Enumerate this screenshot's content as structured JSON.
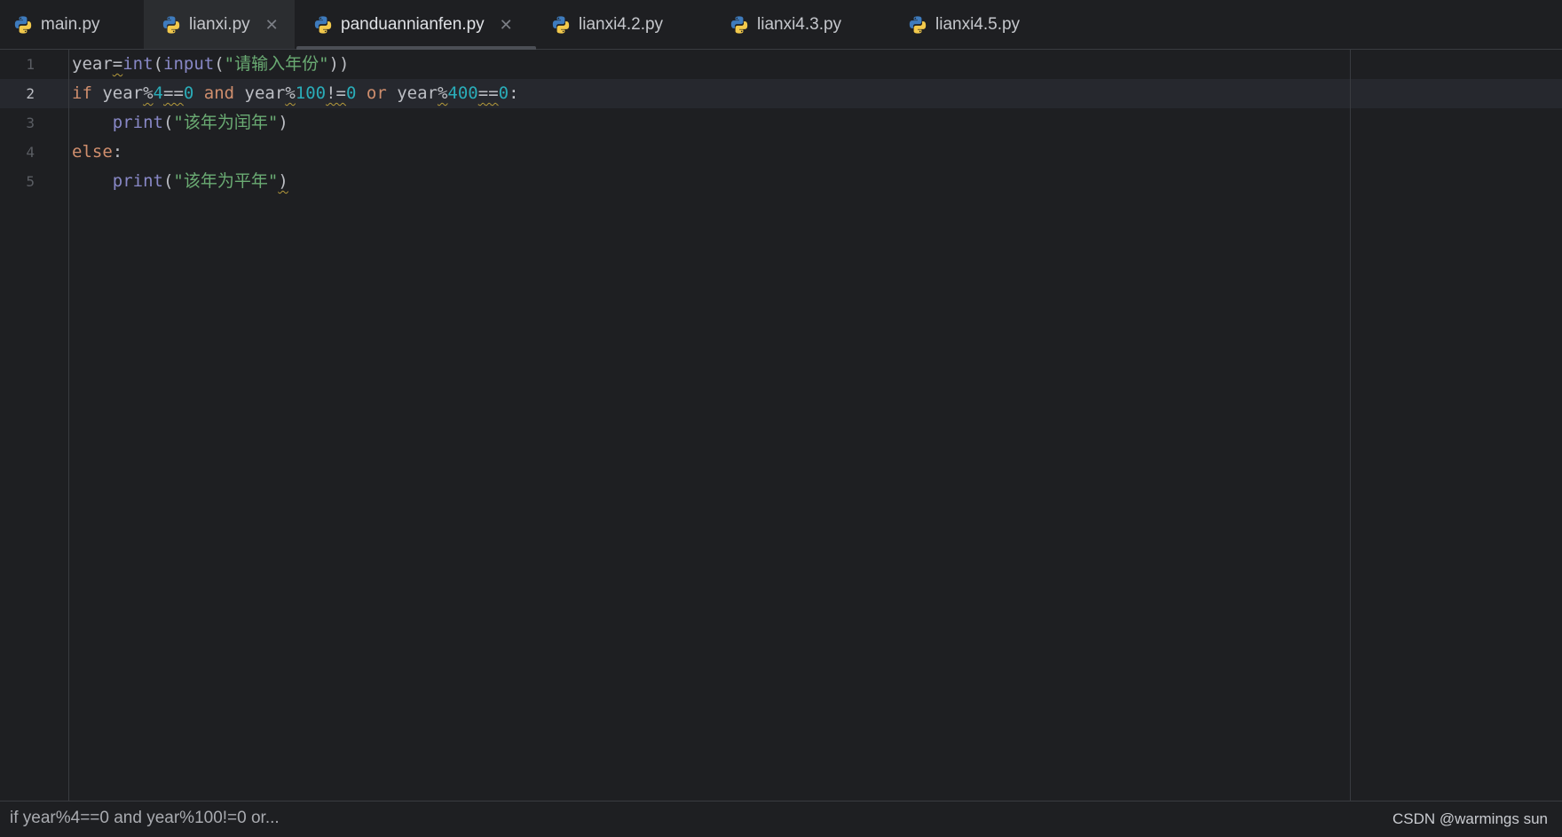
{
  "tabs": [
    {
      "label": "main.py",
      "icon": "python-file-icon",
      "closable": false,
      "active": false
    },
    {
      "label": "lianxi.py",
      "icon": "python-file-icon",
      "closable": true,
      "active": false
    },
    {
      "label": "panduannianfen.py",
      "icon": "python-file-icon",
      "closable": true,
      "active": true
    },
    {
      "label": "lianxi4.2.py",
      "icon": "python-file-icon",
      "closable": false,
      "active": false
    },
    {
      "label": "lianxi4.3.py",
      "icon": "python-file-icon",
      "closable": false,
      "active": false
    },
    {
      "label": "lianxi4.5.py",
      "icon": "python-file-icon",
      "closable": false,
      "active": false
    }
  ],
  "editor": {
    "line_numbers": [
      "1",
      "2",
      "3",
      "4",
      "5"
    ],
    "current_line": 2,
    "lines": [
      [
        {
          "t": "year",
          "c": "ident"
        },
        {
          "t": "=",
          "c": "op",
          "warn": true
        },
        {
          "t": "int",
          "c": "fn"
        },
        {
          "t": "(",
          "c": "op"
        },
        {
          "t": "input",
          "c": "fn"
        },
        {
          "t": "(",
          "c": "op"
        },
        {
          "t": "\"请输入年份\"",
          "c": "str"
        },
        {
          "t": "))",
          "c": "op"
        }
      ],
      [
        {
          "t": "if",
          "c": "kw"
        },
        {
          "t": " year",
          "c": "ident"
        },
        {
          "t": "%",
          "c": "op",
          "warn": true
        },
        {
          "t": "4",
          "c": "num"
        },
        {
          "t": "==",
          "c": "op",
          "warn": true
        },
        {
          "t": "0",
          "c": "num"
        },
        {
          "t": " and",
          "c": "kw"
        },
        {
          "t": " year",
          "c": "ident"
        },
        {
          "t": "%",
          "c": "op",
          "warn": true
        },
        {
          "t": "100",
          "c": "num"
        },
        {
          "t": "!=",
          "c": "op",
          "warn": true
        },
        {
          "t": "0",
          "c": "num"
        },
        {
          "t": " or",
          "c": "kw"
        },
        {
          "t": " year",
          "c": "ident"
        },
        {
          "t": "%",
          "c": "op",
          "warn": true
        },
        {
          "t": "400",
          "c": "num"
        },
        {
          "t": "==",
          "c": "op",
          "warn": true
        },
        {
          "t": "0",
          "c": "num"
        },
        {
          "t": ":",
          "c": "op"
        }
      ],
      [
        {
          "t": "    ",
          "c": "op"
        },
        {
          "t": "print",
          "c": "fn"
        },
        {
          "t": "(",
          "c": "op"
        },
        {
          "t": "\"该年为闰年\"",
          "c": "str"
        },
        {
          "t": ")",
          "c": "op"
        }
      ],
      [
        {
          "t": "else",
          "c": "kw"
        },
        {
          "t": ":",
          "c": "op"
        }
      ],
      [
        {
          "t": "    ",
          "c": "op"
        },
        {
          "t": "print",
          "c": "fn"
        },
        {
          "t": "(",
          "c": "op"
        },
        {
          "t": "\"该年为平年\"",
          "c": "str"
        },
        {
          "t": ")",
          "c": "op",
          "warn": true
        }
      ]
    ]
  },
  "statusbar": {
    "breadcrumb": "if year%4==0 and year%100!=0 or...",
    "watermark": "CSDN @warmings sun"
  },
  "colors": {
    "background": "#1e1f22",
    "keyword": "#cf8e6d",
    "builtin": "#8888c6",
    "number": "#2aacb8",
    "string": "#6aab73",
    "text": "#bcbec4"
  }
}
